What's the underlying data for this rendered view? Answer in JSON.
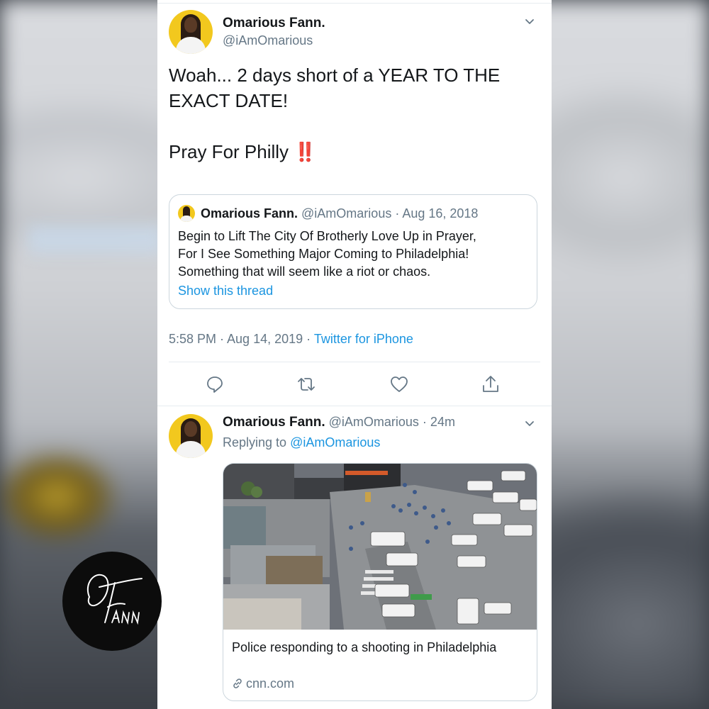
{
  "tweet": {
    "author_name": "Omarious Fann.",
    "author_handle": "@iAmOmarious",
    "text_line1": "Woah... 2 days short of a YEAR TO THE EXACT DATE!",
    "text_line2": "Pray For Philly",
    "text_emoji": "‼️",
    "timestamp": "5:58 PM · Aug 14, 2019 · ",
    "source": "Twitter for iPhone"
  },
  "quoted_tweet": {
    "author_name": "Omarious Fann.",
    "meta": " @iAmOmarious · Aug 16, 2018",
    "body_lines": [
      "Begin to Lift The City Of Brotherly Love Up in Prayer,",
      "For I See Something Major Coming to Philadelphia!",
      "Something that will seem like a riot or chaos."
    ],
    "show_thread": "Show this thread"
  },
  "actions": {
    "reply_icon": "reply-icon",
    "retweet_icon": "retweet-icon",
    "like_icon": "heart-icon",
    "share_icon": "share-icon"
  },
  "reply": {
    "author_name": "Omarious Fann.",
    "meta": " @iAmOmarious · 24m",
    "replying_prefix": "Replying to ",
    "replying_handle": "@iAmOmarious",
    "card_title": "Police responding to a shooting in Philadelphia",
    "card_domain": "cnn.com"
  },
  "colors": {
    "link_blue": "#1b95e0",
    "muted_gray": "#657786",
    "text": "#14171a",
    "emoji_red": "#d0192d"
  }
}
